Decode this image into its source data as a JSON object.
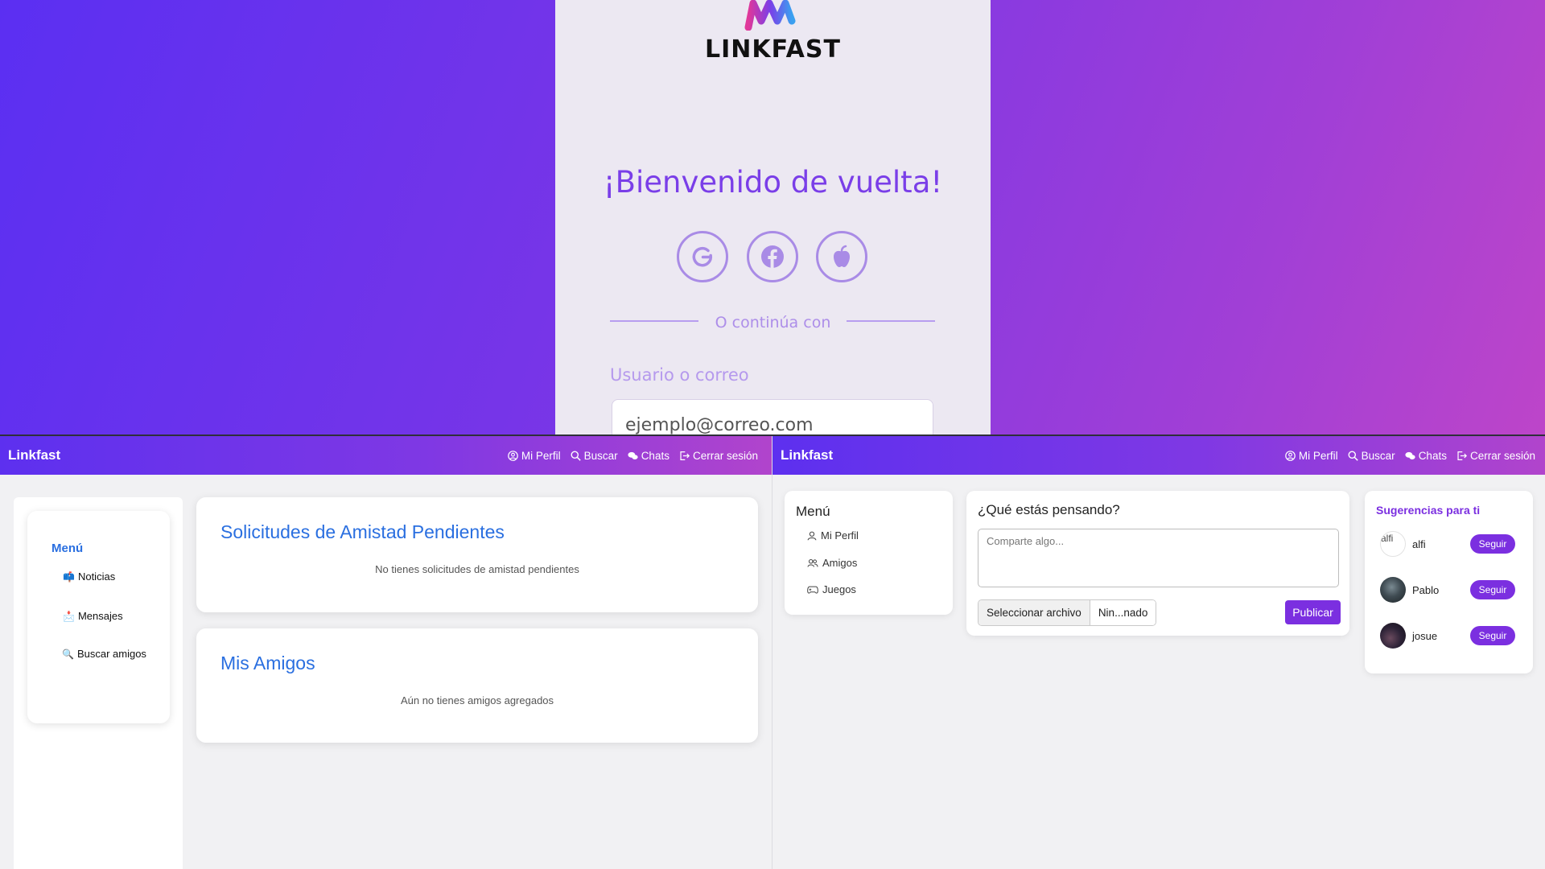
{
  "login": {
    "logo_text": "LINKFAST",
    "welcome": "¡Bienvenido de vuelta!",
    "social": [
      "google-icon",
      "facebook-icon",
      "apple-icon"
    ],
    "divider_text": "O continúa con",
    "username_label": "Usuario o correo",
    "username_placeholder": "ejemplo@correo.com"
  },
  "nav": {
    "brand": "Linkfast",
    "links": [
      "Mi Perfil",
      "Buscar",
      "Chats",
      "Cerrar sesión"
    ]
  },
  "friends_page": {
    "menu_title": "Menú",
    "menu_items": [
      {
        "emoji": "📫",
        "label": "Noticias"
      },
      {
        "emoji": "📩",
        "label": "Mensajes"
      },
      {
        "emoji": "🔍",
        "label": "Buscar amigos"
      }
    ],
    "requests_title": "Solicitudes de Amistad Pendientes",
    "requests_empty": "No tienes solicitudes de amistad pendientes",
    "friends_title": "Mis Amigos",
    "friends_empty": "Aún no tienes amigos agregados"
  },
  "feed_page": {
    "menu_title": "Menú",
    "menu_items": [
      "Mi Perfil",
      "Amigos",
      "Juegos"
    ],
    "post_title": "¿Qué estás pensando?",
    "post_placeholder": "Comparte algo...",
    "file_button": "Seleccionar archivo",
    "file_name": "Nin...nado",
    "publish": "Publicar",
    "suggestions_title": "Sugerencias para ti",
    "suggestions": [
      {
        "name": "alfi",
        "avatar_alt": "alfi"
      },
      {
        "name": "Pablo"
      },
      {
        "name": "josue"
      }
    ],
    "follow_label": "Seguir"
  },
  "colors": {
    "purple": "#7b2fe0",
    "blue_title": "#2a6fe0",
    "gradient_start": "#5b2ff2",
    "gradient_end": "#bd45c9"
  }
}
